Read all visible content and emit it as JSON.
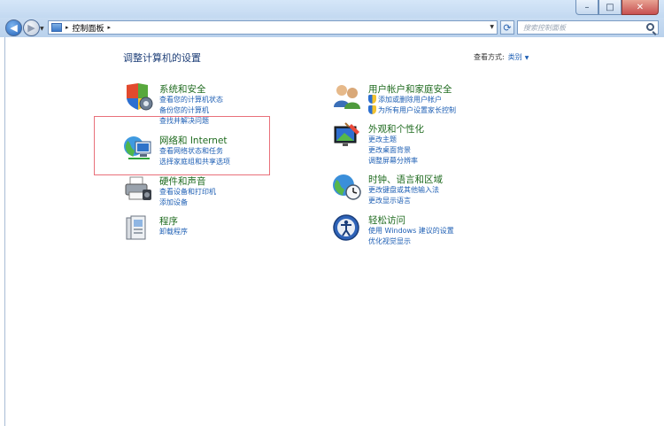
{
  "window": {
    "min_label": "–",
    "max_label": "□",
    "close_label": "✕"
  },
  "address": {
    "crumb": "控制面板",
    "separator": "▸",
    "search_placeholder": "搜索控制面板"
  },
  "main": {
    "title": "调整计算机的设置",
    "view_by_label": "查看方式:",
    "view_by_value": "类别"
  },
  "categories_left": [
    {
      "title": "系统和安全",
      "icon": "shield-icon",
      "links": [
        "查看您的计算机状态",
        "备份您的计算机",
        "查找并解决问题"
      ]
    },
    {
      "title": "网络和 Internet",
      "icon": "network-globe-icon",
      "links": [
        "查看网络状态和任务",
        "选择家庭组和共享选项"
      ]
    },
    {
      "title": "硬件和声音",
      "icon": "printer-icon",
      "links": [
        "查看设备和打印机",
        "添加设备"
      ]
    },
    {
      "title": "程序",
      "icon": "programs-icon",
      "links": [
        "卸载程序"
      ]
    }
  ],
  "categories_right": [
    {
      "title": "用户帐户和家庭安全",
      "icon": "users-icon",
      "links": [
        "添加或删除用户帐户",
        "为所有用户设置家长控制"
      ]
    },
    {
      "title": "外观和个性化",
      "icon": "appearance-icon",
      "links": [
        "更改主题",
        "更改桌面背景",
        "调整屏幕分辨率"
      ]
    },
    {
      "title": "时钟、语言和区域",
      "icon": "clock-globe-icon",
      "links": [
        "更改键盘或其他输入法",
        "更改显示语言"
      ]
    },
    {
      "title": "轻松访问",
      "icon": "ease-of-access-icon",
      "links": [
        "使用 Windows 建议的设置",
        "优化视觉显示"
      ]
    }
  ],
  "colors": {
    "title_green": "#1f6b1f",
    "link_blue": "#1e5fb4",
    "highlight_red": "#e9707a"
  }
}
